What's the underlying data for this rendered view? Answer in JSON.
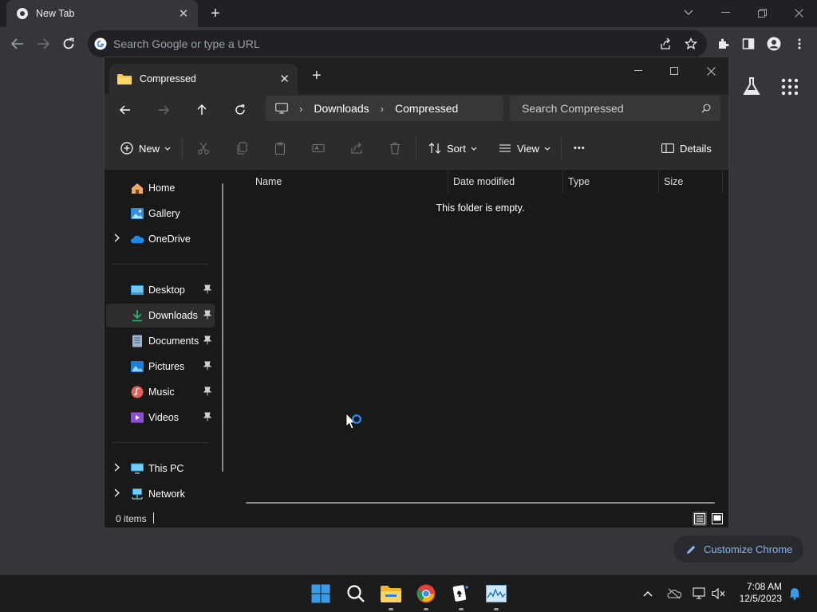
{
  "chrome": {
    "tab_title": "New Tab",
    "omnibox_placeholder": "Search Google or type a URL",
    "customize_label": "Customize Chrome"
  },
  "explorer": {
    "tab_title": "Compressed",
    "breadcrumb": [
      "Downloads",
      "Compressed"
    ],
    "search_placeholder": "Search Compressed",
    "commands": {
      "new": "New",
      "sort": "Sort",
      "view": "View",
      "more": "•••",
      "details": "Details"
    },
    "nav": {
      "home": "Home",
      "gallery": "Gallery",
      "onedrive": "OneDrive",
      "desktop": "Desktop",
      "downloads": "Downloads",
      "documents": "Documents",
      "pictures": "Pictures",
      "music": "Music",
      "videos": "Videos",
      "thispc": "This PC",
      "network": "Network"
    },
    "columns": [
      "Name",
      "Date modified",
      "Type",
      "Size"
    ],
    "empty_message": "This folder is empty.",
    "status": "0 items"
  },
  "taskbar": {
    "time": "7:08 AM",
    "date": "12/5/2023"
  },
  "colors": {
    "chrome_bg": "#35363a",
    "explorer_bg": "#191919",
    "accent_blue": "#8ab4f8",
    "windows_blue": "#0078d4"
  }
}
